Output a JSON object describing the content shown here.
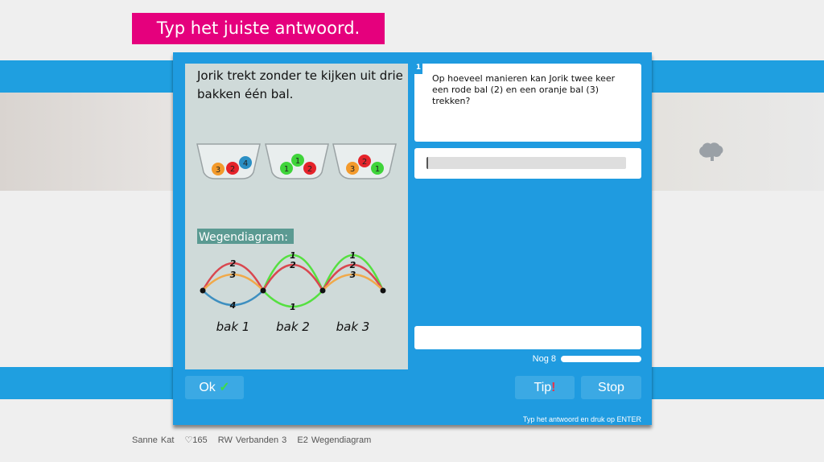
{
  "banner": "Typ het juiste antwoord.",
  "question": {
    "intro": "Jorik trekt zonder te kijken uit drie bakken één bal.",
    "number": "1",
    "text": "Op hoeveel manieren kan Jorik twee keer een rode bal (2) en een oranje bal (3) trekken?",
    "answer_value": ""
  },
  "illustration": {
    "bowls": [
      {
        "balls": [
          {
            "n": "3",
            "color": "#f39a2b"
          },
          {
            "n": "2",
            "color": "#e5232a"
          },
          {
            "n": "4",
            "color": "#2a8fc4"
          }
        ]
      },
      {
        "balls": [
          {
            "n": "1",
            "color": "#3fd43a"
          },
          {
            "n": "1",
            "color": "#3fd43a"
          },
          {
            "n": "2",
            "color": "#e5232a"
          }
        ]
      },
      {
        "balls": [
          {
            "n": "3",
            "color": "#f39a2b"
          },
          {
            "n": "2",
            "color": "#e5232a"
          },
          {
            "n": "1",
            "color": "#3fd43a"
          }
        ]
      }
    ],
    "diagram_label": "Wegendiagram:",
    "bak_labels": [
      "bak 1",
      "bak 2",
      "bak 3"
    ],
    "paths": [
      [
        {
          "n": "2",
          "color": "#d9474f"
        },
        {
          "n": "3",
          "color": "#f0a94a"
        },
        {
          "n": "4",
          "color": "#3e8fc0"
        }
      ],
      [
        {
          "n": "1",
          "color": "#55e040"
        },
        {
          "n": "2",
          "color": "#d9474f"
        },
        {
          "n": "1",
          "color": "#55e040"
        }
      ],
      [
        {
          "n": "1",
          "color": "#55e040"
        },
        {
          "n": "2",
          "color": "#d9474f"
        },
        {
          "n": "3",
          "color": "#f0a94a"
        }
      ]
    ]
  },
  "progress": {
    "label": "Nog 8"
  },
  "buttons": {
    "ok": "Ok",
    "ok_mark": "✓",
    "tip": "Tip",
    "tip_mark": "!",
    "stop": "Stop"
  },
  "hint": "Typ het antwoord en druk op ENTER",
  "footer": {
    "user": "Sanne Kat",
    "hearts": "♡165",
    "course": "RW Verbanden 3",
    "exercise": "E2 Wegendiagram"
  },
  "colors": {
    "blue": "#1f9be0",
    "pink": "#e5007d",
    "ok_check": "#3ddc4a",
    "tip_mark": "#e8334a"
  }
}
